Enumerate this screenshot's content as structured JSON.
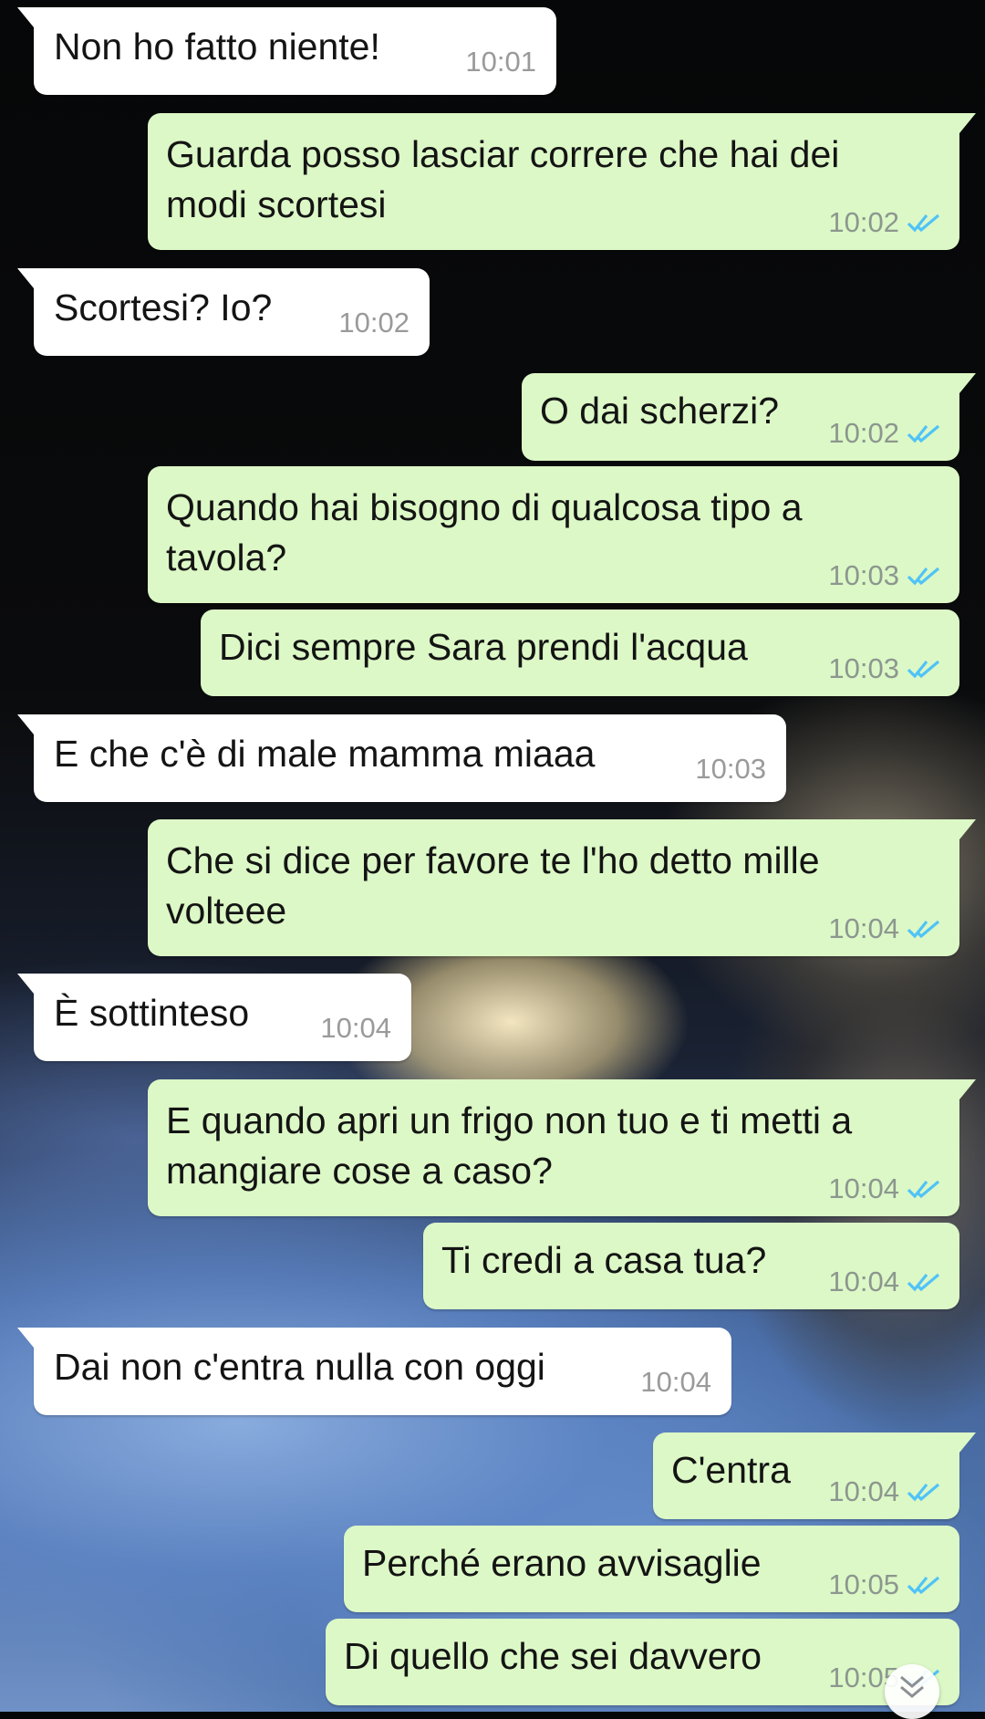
{
  "messages": [
    {
      "direction": "in",
      "text": "Non ho fatto niente!",
      "time": "10:01",
      "tail": true
    },
    {
      "direction": "out",
      "text": "Guarda posso lasciar correre che hai dei\nmodi scortesi",
      "time": "10:02",
      "status": "read",
      "tail": true
    },
    {
      "direction": "in",
      "text": "Scortesi? Io?",
      "time": "10:02",
      "tail": true
    },
    {
      "direction": "out",
      "text": "O dai scherzi?",
      "time": "10:02",
      "status": "read",
      "tail": true
    },
    {
      "direction": "out",
      "text": "Quando hai bisogno di qualcosa tipo a\ntavola?",
      "time": "10:03",
      "status": "read",
      "tail": false
    },
    {
      "direction": "out",
      "text": "Dici sempre Sara prendi l'acqua",
      "time": "10:03",
      "status": "read",
      "tail": false
    },
    {
      "direction": "in",
      "text": "E che c'è di male mamma miaaa",
      "time": "10:03",
      "tail": true
    },
    {
      "direction": "out",
      "text": "Che si dice per favore te l'ho detto mille\nvolteee",
      "time": "10:04",
      "status": "read",
      "tail": true
    },
    {
      "direction": "in",
      "text": "È sottinteso",
      "time": "10:04",
      "tail": true
    },
    {
      "direction": "out",
      "text": "E quando apri un frigo non tuo e ti metti a\nmangiare cose a caso?",
      "time": "10:04",
      "status": "read",
      "tail": true
    },
    {
      "direction": "out",
      "text": "Ti credi a casa tua?",
      "time": "10:04",
      "status": "read",
      "tail": false
    },
    {
      "direction": "in",
      "text": "Dai non c'entra nulla con oggi",
      "time": "10:04",
      "tail": true
    },
    {
      "direction": "out",
      "text": "C'entra",
      "time": "10:04",
      "status": "read",
      "tail": true
    },
    {
      "direction": "out",
      "text": "Perché erano avvisaglie",
      "time": "10:05",
      "status": "read",
      "tail": false
    },
    {
      "direction": "out",
      "text": "Di quello che sei davvero",
      "time": "10:05",
      "status": "read",
      "tail": false
    }
  ],
  "colors": {
    "incoming_bubble": "#ffffff",
    "outgoing_bubble": "#dcf8c6",
    "read_ticks": "#4fc3f7"
  },
  "icons": {
    "read_receipt": "double-check-icon",
    "scroll_down": "chevron-double-down-icon"
  }
}
